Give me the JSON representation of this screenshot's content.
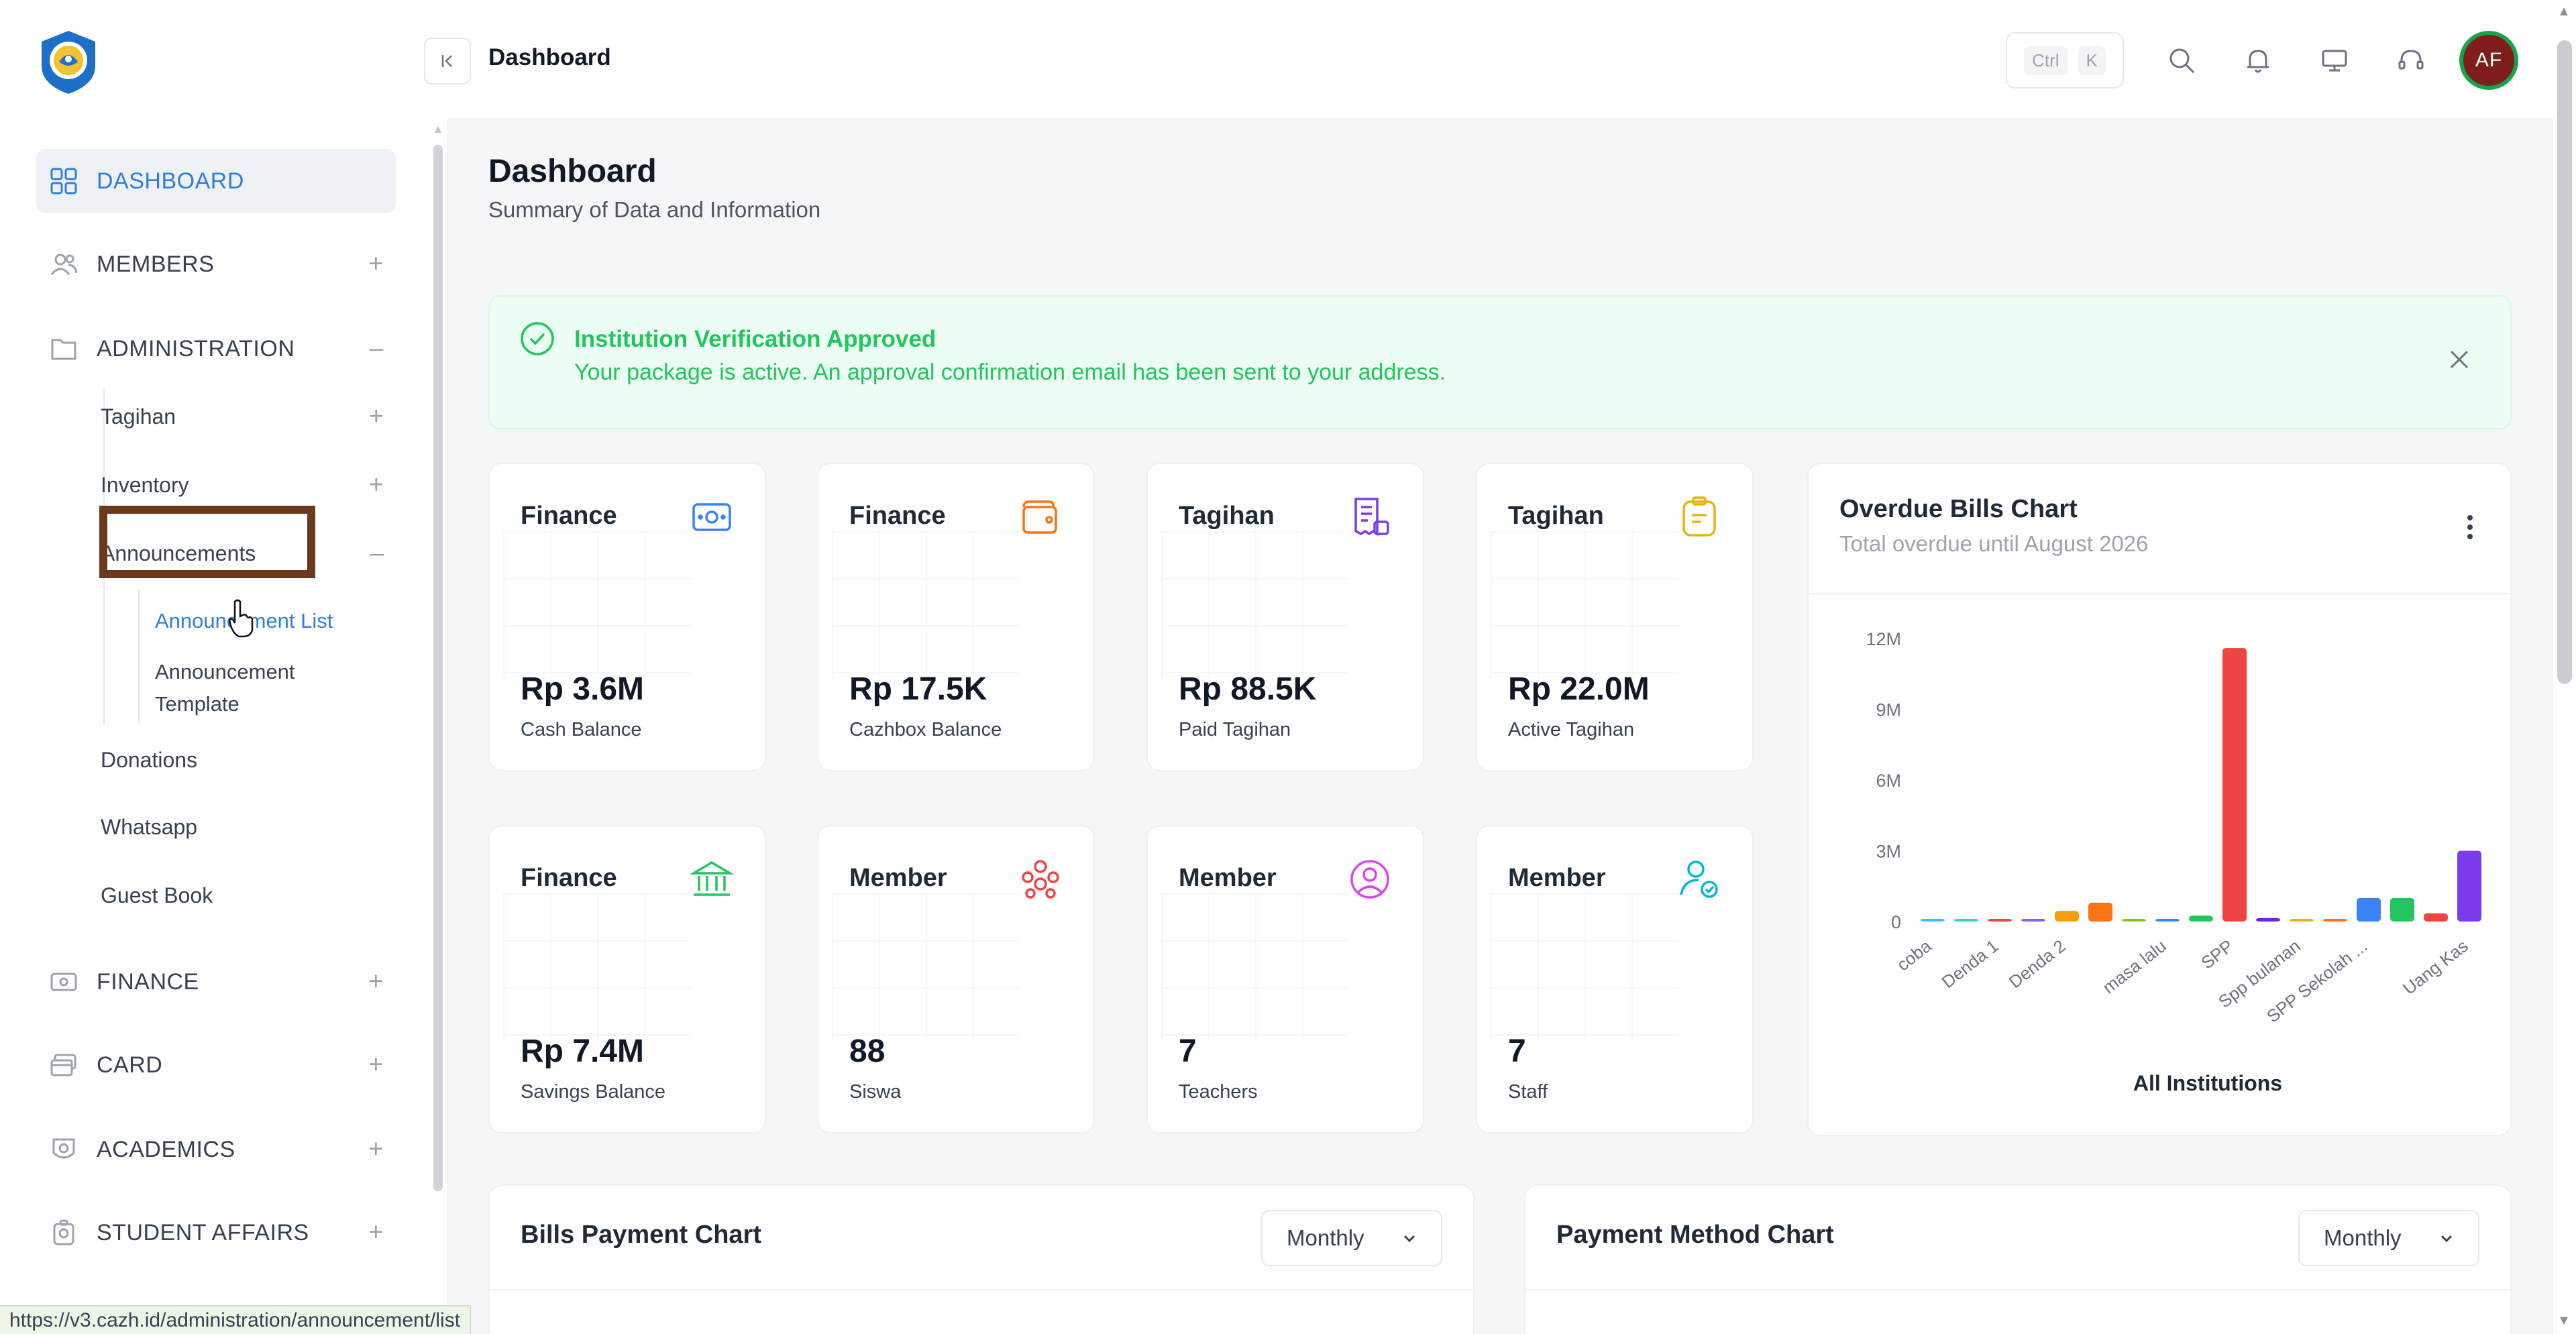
{
  "topbar": {
    "title": "Dashboard",
    "kbd_ctrl": "Ctrl",
    "kbd_k": "K",
    "avatar_initials": "AF"
  },
  "sidebar": {
    "items": {
      "dashboard": "DASHBOARD",
      "members": "MEMBERS",
      "administration": "ADMINISTRATION",
      "finance": "FINANCE",
      "card": "CARD",
      "academics": "ACADEMICS",
      "student_affairs": "STUDENT AFFAIRS"
    },
    "admin_sub": {
      "tagihan": "Tagihan",
      "inventory": "Inventory",
      "announcements": "Announcements",
      "donations": "Donations",
      "whatsapp": "Whatsapp",
      "guest_book": "Guest Book"
    },
    "announcements_sub": {
      "list": "Announcement List",
      "template_line1": "Announcement",
      "template_line2": "Template"
    },
    "toggles": {
      "plus": "+",
      "minus": "–"
    }
  },
  "main": {
    "title": "Dashboard",
    "subtitle": "Summary of Data and Information",
    "alert": {
      "title": "Institution Verification Approved",
      "text": "Your package is active. An approval confirmation email has been sent to your address."
    },
    "cards": [
      {
        "title": "Finance",
        "value": "Rp 3.6M",
        "label": "Cash Balance",
        "icon": "cash-icon",
        "color": "#3b82f6"
      },
      {
        "title": "Finance",
        "value": "Rp 17.5K",
        "label": "Cazhbox Balance",
        "icon": "wallet-icon",
        "color": "#f97316"
      },
      {
        "title": "Tagihan",
        "value": "Rp 88.5K",
        "label": "Paid Tagihan",
        "icon": "receipt-icon",
        "color": "#7c3aed"
      },
      {
        "title": "Tagihan",
        "value": "Rp 22.0M",
        "label": "Active Tagihan",
        "icon": "clipboard-icon",
        "color": "#eab308"
      },
      {
        "title": "Finance",
        "value": "Rp 7.4M",
        "label": "Savings Balance",
        "icon": "bank-icon",
        "color": "#22c55e"
      },
      {
        "title": "Member",
        "value": "88",
        "label": "Siswa",
        "icon": "group-icon",
        "color": "#ef4444"
      },
      {
        "title": "Member",
        "value": "7",
        "label": "Teachers",
        "icon": "user-circle-icon",
        "color": "#d946ef"
      },
      {
        "title": "Member",
        "value": "7",
        "label": "Staff",
        "icon": "user-check-icon",
        "color": "#06b6d4"
      }
    ],
    "overdue_chart": {
      "title": "Overdue Bills Chart",
      "subtitle": "Total overdue until August 2026",
      "xlabel": "All Institutions"
    },
    "bills_panel": {
      "title": "Bills Payment Chart",
      "select": "Monthly"
    },
    "payment_panel": {
      "title": "Payment Method Chart",
      "select": "Monthly"
    }
  },
  "chart_data": {
    "type": "bar",
    "title": "Overdue Bills Chart",
    "subtitle": "Total overdue until August 2026",
    "xlabel": "All Institutions",
    "ylabel": "",
    "ylim": [
      0,
      12000000
    ],
    "yticks": [
      "0",
      "3M",
      "6M",
      "9M",
      "12M"
    ],
    "categories": [
      "coba",
      "",
      "Denda 1",
      "",
      "Denda 2",
      "",
      "",
      "masa lalu",
      "",
      "SPP",
      "",
      "Spp bulanan",
      "",
      "SPP Sekolah ...",
      "",
      "",
      "Uang Kas"
    ],
    "values": [
      50000,
      80000,
      80000,
      80000,
      450000,
      800000,
      0,
      0,
      250000,
      11600000,
      150000,
      100000,
      0,
      1000000,
      1000000,
      350000,
      3000000
    ],
    "colors": [
      "#38bdf8",
      "#2dd4bf",
      "#ef4444",
      "#8b5cf6",
      "#f59e0b",
      "#f97316",
      "#84cc16",
      "#3b82f6",
      "#22c55e",
      "#ef4444",
      "#6d28d9",
      "#eab308",
      "#f97316",
      "#3b82f6",
      "#22c55e",
      "#ef4444",
      "#7c3aed"
    ]
  },
  "status_url": "https://v3.cazh.id/administration/announcement/list"
}
